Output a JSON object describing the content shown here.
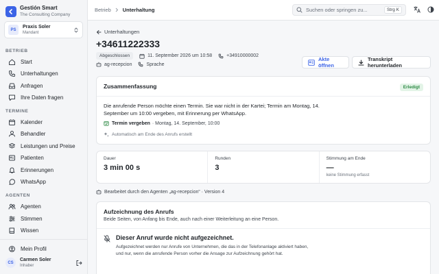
{
  "brand": {
    "name": "Gestión Smart",
    "subtitle": "The Consulting Company"
  },
  "tenant": {
    "initials": "PS",
    "name": "Praxis Soler",
    "role": "Mandant"
  },
  "sidebar": {
    "sections": [
      {
        "label": "BETRIEB",
        "items": [
          {
            "label": "Start",
            "icon": "home-icon"
          },
          {
            "label": "Unterhaltungen",
            "icon": "phone-icon"
          },
          {
            "label": "Anfragen",
            "icon": "inbox-icon"
          },
          {
            "label": "Ihre Daten fragen",
            "icon": "chat-icon"
          }
        ]
      },
      {
        "label": "TERMINE",
        "items": [
          {
            "label": "Kalender",
            "icon": "calendar-icon"
          },
          {
            "label": "Behandler",
            "icon": "user-icon"
          },
          {
            "label": "Leistungen und Preise",
            "icon": "layers-icon"
          },
          {
            "label": "Patienten",
            "icon": "id-card-icon"
          },
          {
            "label": "Erinnerungen",
            "icon": "bell-icon"
          },
          {
            "label": "WhatsApp",
            "icon": "whatsapp-icon"
          }
        ]
      },
      {
        "label": "AGENTEN",
        "items": [
          {
            "label": "Agenten",
            "icon": "agents-icon"
          },
          {
            "label": "Stimmen",
            "icon": "sliders-icon"
          },
          {
            "label": "Wissen",
            "icon": "book-icon"
          }
        ]
      }
    ],
    "profile_label": "Mein Profil"
  },
  "user": {
    "initials": "CS",
    "name": "Carmen Soler",
    "role": "Inhaber"
  },
  "topbar": {
    "breadcrumb": [
      "Betrieb",
      "Unterhaltung"
    ],
    "search_placeholder": "Suchen oder springen zu...",
    "search_shortcut": "Strg K"
  },
  "conversation": {
    "back_label": "Unterhaltungen",
    "title": "+34611222333",
    "status": "Abgeschlossen",
    "datetime": "11. September 2026 um 10:58",
    "called_number": "+34910000002",
    "agent": "ag-recepcion",
    "channel": "Sprache",
    "open_agent_label": "Akte öffnen",
    "download_label": "Transkript herunterladen"
  },
  "summary": {
    "title": "Zusammenfassung",
    "badge": "Erledigt",
    "text": "Die anrufende Person möchte einen Termin. Sie war nicht in der Kartei; Termin am Montag, 14. September um 10:00 vergeben, mit Erinnerung per WhatsApp.",
    "action_label": "Termin vergeben",
    "action_detail": "· Montag, 14. September, 10:00",
    "auto_note": "Automatisch am Ende des Anrufs erstellt"
  },
  "stats": [
    {
      "label": "Dauer",
      "value": "3 min 00 s",
      "sub": ""
    },
    {
      "label": "Runden",
      "value": "3",
      "sub": ""
    },
    {
      "label": "Stimmung am Ende",
      "value": "—",
      "sub": "keine Stimmung erfasst"
    }
  ],
  "agent_line": "Bearbeitet durch den Agenten „ag-recepcion“ · Version 4",
  "recording": {
    "title": "Aufzeichnung des Anrufs",
    "subtitle": "Beide Seiten, von Anfang bis Ende, auch nach einer Weiterleitung an eine Person.",
    "empty_title": "Dieser Anruf wurde nicht aufgezeichnet.",
    "empty_text": "Aufgezeichnet werden nur Anrufe von Unternehmen, die das in der Telefonanlage aktiviert haben, und nur, wenn die anrufende Person vorher die Ansage zur Aufzeichnung gehört hat."
  },
  "colors": {
    "accent": "#3b63e6",
    "success": "#2e8a45",
    "success_bg": "#e3f4e7"
  }
}
